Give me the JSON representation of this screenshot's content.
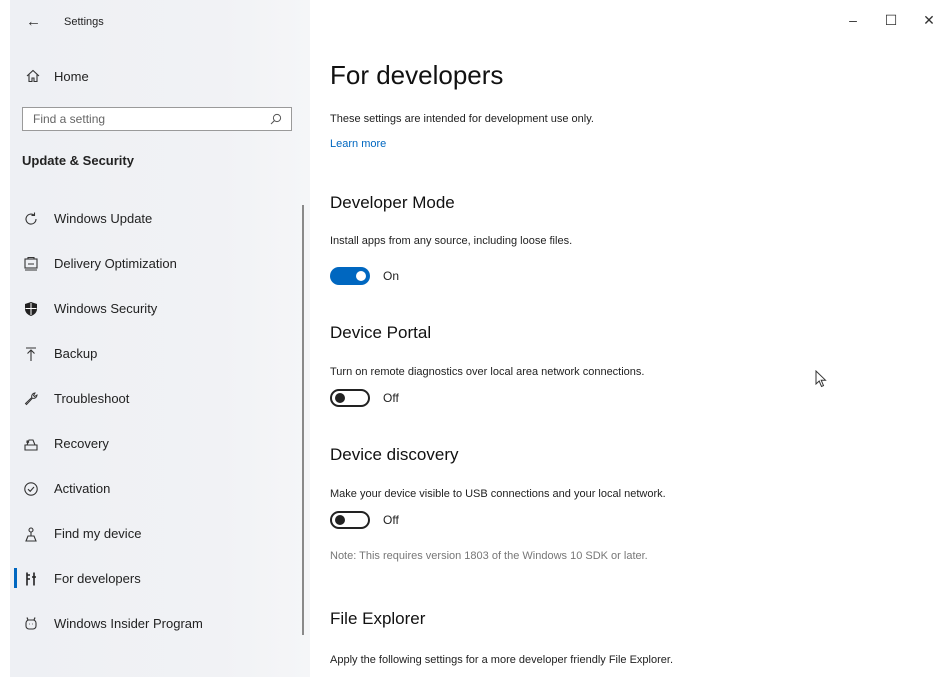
{
  "window": {
    "title": "Settings",
    "back_icon": "back-arrow-icon",
    "controls": {
      "minimize": "–",
      "maximize": "☐",
      "close": "✕"
    }
  },
  "sidebar": {
    "home_label": "Home",
    "search_placeholder": "Find a setting",
    "section_title": "Update & Security",
    "items": [
      {
        "label": "Windows Update",
        "icon": "refresh-icon"
      },
      {
        "label": "Delivery Optimization",
        "icon": "delivery-optimization-icon"
      },
      {
        "label": "Windows Security",
        "icon": "shield-icon"
      },
      {
        "label": "Backup",
        "icon": "backup-arrow-icon"
      },
      {
        "label": "Troubleshoot",
        "icon": "wrench-icon"
      },
      {
        "label": "Recovery",
        "icon": "recovery-icon"
      },
      {
        "label": "Activation",
        "icon": "check-circle-icon"
      },
      {
        "label": "Find my device",
        "icon": "find-device-icon"
      },
      {
        "label": "For developers",
        "icon": "developer-icon"
      },
      {
        "label": "Windows Insider Program",
        "icon": "insider-icon"
      }
    ],
    "active_index": 8
  },
  "main": {
    "title": "For developers",
    "intro": "These settings are intended for development use only.",
    "learn_more": "Learn more",
    "developer_mode": {
      "heading": "Developer Mode",
      "description": "Install apps from any source, including loose files.",
      "toggle_state": "On",
      "on": true
    },
    "device_portal": {
      "heading": "Device Portal",
      "description": "Turn on remote diagnostics over local area network connections.",
      "toggle_state": "Off",
      "on": false
    },
    "device_discovery": {
      "heading": "Device discovery",
      "description": "Make your device visible to USB connections and your local network.",
      "toggle_state": "Off",
      "on": false,
      "note": "Note: This requires version 1803 of the Windows 10 SDK or later."
    },
    "file_explorer": {
      "heading": "File Explorer",
      "description": "Apply the following settings for a more developer friendly File Explorer."
    }
  },
  "colors": {
    "accent": "#0067c0",
    "sidebar_bg": "#eef0f4",
    "note_text": "#777777"
  }
}
